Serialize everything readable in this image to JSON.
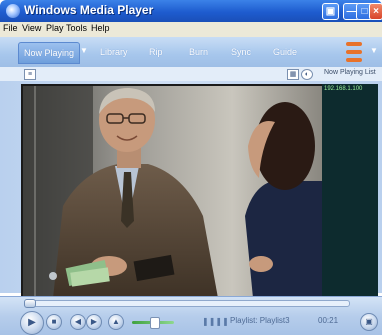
{
  "window": {
    "title": "Windows Media Player"
  },
  "menu": {
    "items": [
      {
        "label": "File"
      },
      {
        "label": "View"
      },
      {
        "label": "Play"
      },
      {
        "label": "Tools"
      },
      {
        "label": "Help"
      }
    ]
  },
  "tabs": [
    {
      "label": "Now Playing",
      "active": true
    },
    {
      "label": "Library"
    },
    {
      "label": "Rip"
    },
    {
      "label": "Burn"
    },
    {
      "label": "Sync"
    },
    {
      "label": "Guide"
    }
  ],
  "subbar": {
    "now_playing_list_label": "Now Playing List"
  },
  "playlist": {
    "entries": [
      "192.168.1.100"
    ]
  },
  "status": {
    "playlist_text": "Playlist: Playlist3",
    "time": "00:21"
  },
  "icons": {
    "app": "media-player-icon",
    "minimize": "minimize-icon",
    "maximize": "maximize-icon",
    "close": "close-icon",
    "play": "play-icon",
    "stop": "stop-icon",
    "previous": "previous-icon",
    "next": "next-icon",
    "mute": "speaker-icon"
  },
  "colors": {
    "titlebar": "#1e5ccf",
    "playlist_bg": "#0d2b2e",
    "playlist_text": "#9ff29c"
  }
}
